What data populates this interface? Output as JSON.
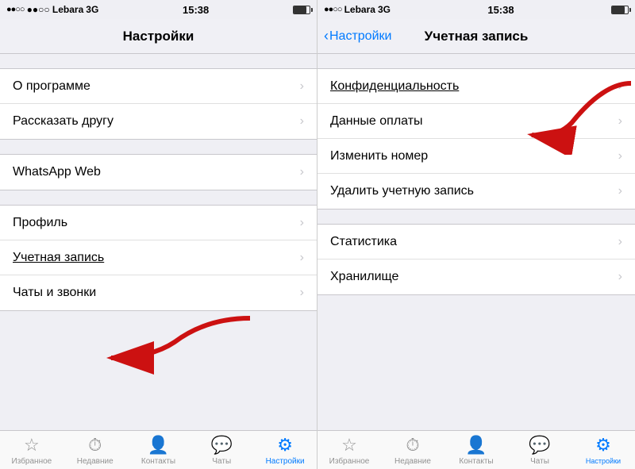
{
  "left_panel": {
    "status": {
      "carrier": "●●○○ Lebara",
      "network": "3G",
      "time": "15:38"
    },
    "nav_title": "Настройки",
    "sections": [
      {
        "items": [
          {
            "label": "О программе",
            "id": "about"
          },
          {
            "label": "Рассказать другу",
            "id": "share"
          }
        ]
      },
      {
        "items": [
          {
            "label": "WhatsApp Web",
            "id": "whatsapp-web"
          }
        ]
      },
      {
        "items": [
          {
            "label": "Профиль",
            "id": "profile"
          },
          {
            "label": "Учетная запись",
            "id": "account",
            "underlined": true
          },
          {
            "label": "Чаты и звонки",
            "id": "chats"
          }
        ]
      }
    ],
    "tabs": [
      {
        "label": "Избранное",
        "icon": "☆",
        "active": false
      },
      {
        "label": "Недавние",
        "icon": "🕐",
        "active": false
      },
      {
        "label": "Контакты",
        "icon": "👤",
        "active": false
      },
      {
        "label": "Чаты",
        "icon": "💬",
        "active": false
      },
      {
        "label": "Настройки",
        "icon": "⚙",
        "active": true
      }
    ]
  },
  "right_panel": {
    "status": {
      "carrier": "●●○○ Lebara",
      "network": "3G",
      "time": "15:38"
    },
    "nav_back": "Настройки",
    "nav_title": "Учетная запись",
    "sections": [
      {
        "items": [
          {
            "label": "Конфиденциальность",
            "id": "privacy",
            "underlined": true
          },
          {
            "label": "Данные оплаты",
            "id": "payment"
          },
          {
            "label": "Изменить номер",
            "id": "change-number"
          },
          {
            "label": "Удалить учетную запись",
            "id": "delete-account"
          }
        ]
      },
      {
        "items": [
          {
            "label": "Статистика",
            "id": "stats"
          },
          {
            "label": "Хранилище",
            "id": "storage"
          }
        ]
      }
    ],
    "tabs": [
      {
        "label": "Избранное",
        "icon": "☆",
        "active": false
      },
      {
        "label": "Недавние",
        "icon": "🕐",
        "active": false
      },
      {
        "label": "Контакты",
        "icon": "👤",
        "active": false
      },
      {
        "label": "Чаты",
        "icon": "💬",
        "active": false
      },
      {
        "label": "Настройки",
        "icon": "⚙",
        "active": true
      }
    ]
  },
  "arrows": {
    "left_arrow_label": "pointing to Учетная запись",
    "right_arrow_label": "pointing to Конфиденциальность"
  }
}
